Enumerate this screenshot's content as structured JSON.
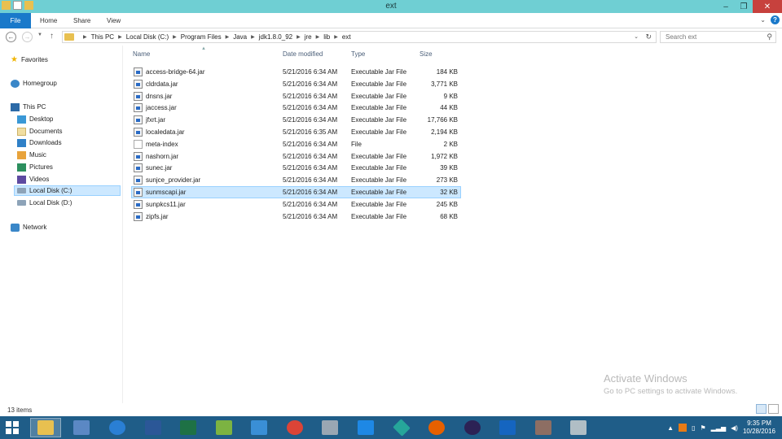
{
  "window": {
    "title": "ext"
  },
  "ribbon": {
    "tabs": [
      "File",
      "Home",
      "Share",
      "View"
    ]
  },
  "address": {
    "crumbs": [
      "This PC",
      "Local Disk (C:)",
      "Program Files",
      "Java",
      "jdk1.8.0_92",
      "jre",
      "lib",
      "ext"
    ]
  },
  "search": {
    "placeholder": "Search ext"
  },
  "nav": {
    "favorites": "Favorites",
    "homegroup": "Homegroup",
    "thispc": "This PC",
    "items": [
      "Desktop",
      "Documents",
      "Downloads",
      "Music",
      "Pictures",
      "Videos",
      "Local Disk (C:)",
      "Local Disk (D:)"
    ],
    "network": "Network"
  },
  "columns": {
    "name": "Name",
    "date": "Date modified",
    "type": "Type",
    "size": "Size"
  },
  "files": [
    {
      "name": "access-bridge-64.jar",
      "date": "5/21/2016 6:34 AM",
      "type": "Executable Jar File",
      "size": "184 KB"
    },
    {
      "name": "cldrdata.jar",
      "date": "5/21/2016 6:34 AM",
      "type": "Executable Jar File",
      "size": "3,771 KB"
    },
    {
      "name": "dnsns.jar",
      "date": "5/21/2016 6:34 AM",
      "type": "Executable Jar File",
      "size": "9 KB"
    },
    {
      "name": "jaccess.jar",
      "date": "5/21/2016 6:34 AM",
      "type": "Executable Jar File",
      "size": "44 KB"
    },
    {
      "name": "jfxrt.jar",
      "date": "5/21/2016 6:34 AM",
      "type": "Executable Jar File",
      "size": "17,766 KB"
    },
    {
      "name": "localedata.jar",
      "date": "5/21/2016 6:35 AM",
      "type": "Executable Jar File",
      "size": "2,194 KB"
    },
    {
      "name": "meta-index",
      "date": "5/21/2016 6:34 AM",
      "type": "File",
      "size": "2 KB"
    },
    {
      "name": "nashorn.jar",
      "date": "5/21/2016 6:34 AM",
      "type": "Executable Jar File",
      "size": "1,972 KB"
    },
    {
      "name": "sunec.jar",
      "date": "5/21/2016 6:34 AM",
      "type": "Executable Jar File",
      "size": "39 KB"
    },
    {
      "name": "sunjce_provider.jar",
      "date": "5/21/2016 6:34 AM",
      "type": "Executable Jar File",
      "size": "273 KB"
    },
    {
      "name": "sunmscapi.jar",
      "date": "5/21/2016 6:34 AM",
      "type": "Executable Jar File",
      "size": "32 KB"
    },
    {
      "name": "sunpkcs11.jar",
      "date": "5/21/2016 6:34 AM",
      "type": "Executable Jar File",
      "size": "245 KB"
    },
    {
      "name": "zipfs.jar",
      "date": "5/21/2016 6:34 AM",
      "type": "Executable Jar File",
      "size": "68 KB"
    }
  ],
  "status": {
    "count": "13 items"
  },
  "watermark": {
    "line1": "Activate Windows",
    "line2": "Go to PC settings to activate Windows."
  },
  "clock": {
    "time": "9:35 PM",
    "date": "10/28/2016"
  },
  "colors": {
    "titlebar": "#6fcfd3",
    "file_tab": "#1979ca",
    "selection": "#cce8ff",
    "taskbar": "#1f5d88"
  }
}
